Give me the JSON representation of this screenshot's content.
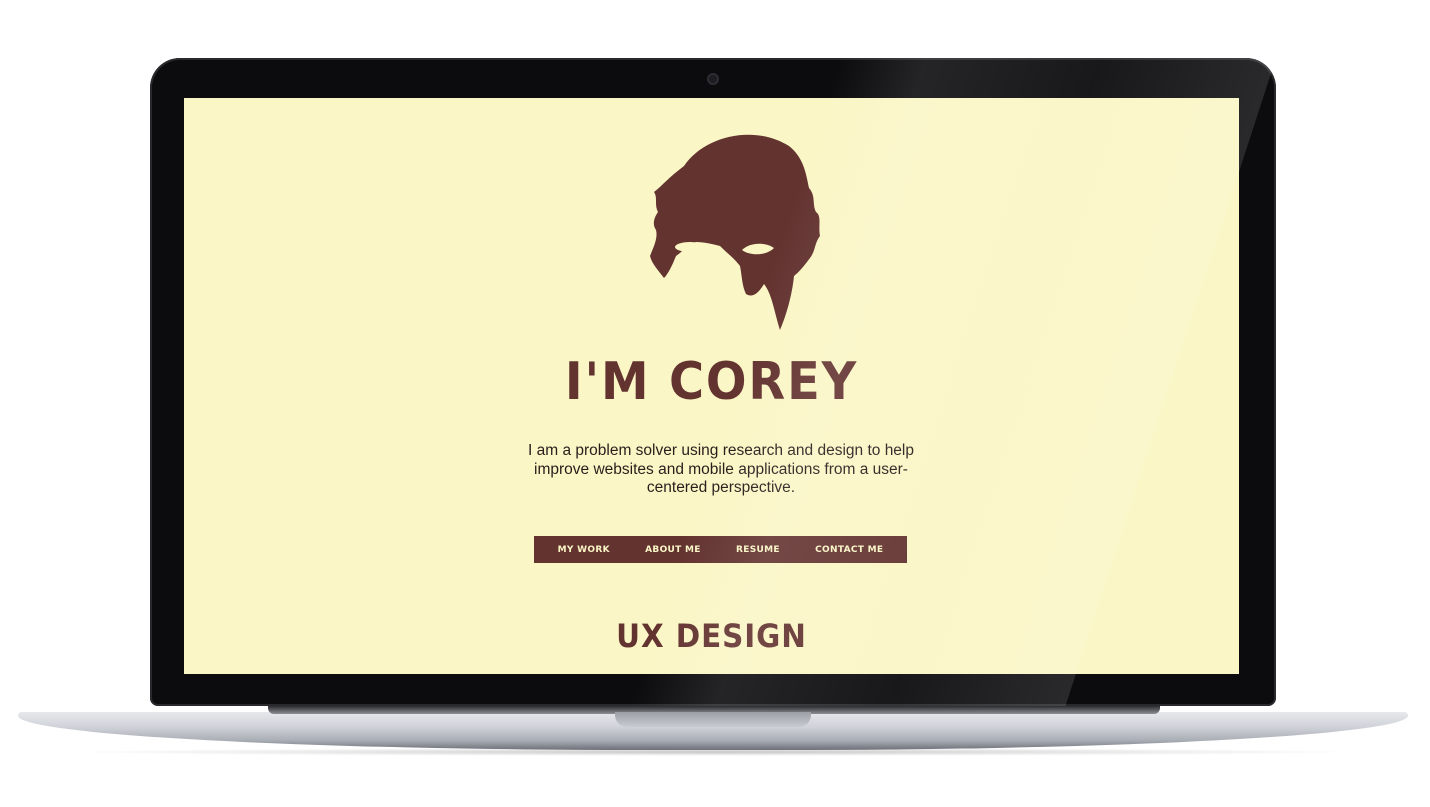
{
  "colors": {
    "background": "#fbf6c6",
    "accent": "#633330",
    "body_text": "#2a1d1b"
  },
  "hero": {
    "avatar_icon": "hair-silhouette-avatar",
    "title": "I'M COREY",
    "intro": "I am a problem solver using research and design to help improve websites and mobile applications from a user-centered perspective."
  },
  "nav": {
    "items": [
      {
        "label": "MY WORK"
      },
      {
        "label": "ABOUT ME"
      },
      {
        "label": "RESUME"
      },
      {
        "label": "CONTACT ME"
      }
    ]
  },
  "section": {
    "title": "UX DESIGN"
  }
}
